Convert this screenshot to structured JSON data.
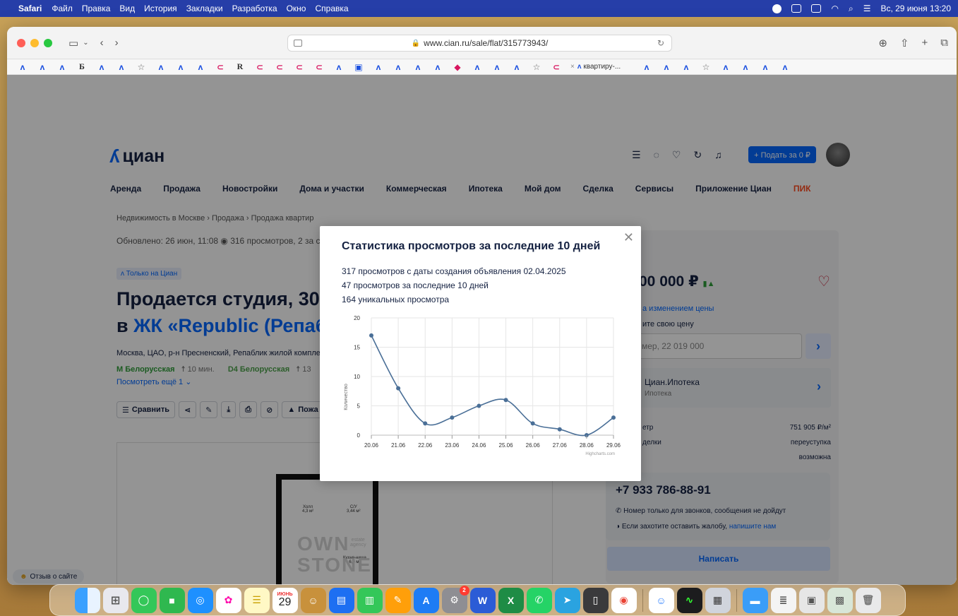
{
  "menubar": {
    "app": "Safari",
    "items": [
      "Файл",
      "Правка",
      "Вид",
      "История",
      "Закладки",
      "Разработка",
      "Окно",
      "Справка"
    ],
    "clock": "Вс, 29 июня 13:20"
  },
  "browser": {
    "url": "www.cian.ru/sale/flat/315773943/",
    "active_tab_label": "квартиру-..."
  },
  "site": {
    "logo": "циан",
    "post_button": "+ Подать за 0 ₽",
    "nav": [
      "Аренда",
      "Продажа",
      "Новостройки",
      "Дома и участки",
      "Коммерческая",
      "Ипотека",
      "Мой дом",
      "Сделка",
      "Сервисы",
      "Приложение Циан",
      "ПИК"
    ]
  },
  "listing": {
    "breadcrumbs": "Недвижимость в Москве  ›  Продажа  ›  Продажа квартир",
    "updated": "Обновлено: 26 июн, 11:08   ◉  316 просмотров, 2 за се",
    "badge": "Только на Циан",
    "title_line1": "Продается студия, 30",
    "title_line2_prefix": "в ",
    "title_line2_link": "ЖК «Republic (Репаб",
    "address": "Москва, ЦАО, р-н Пресненский, Репаблик жилой компле",
    "metro1": "М Белорусская",
    "metro1_time": "☨ 10 мин.",
    "metro2": "D4 Белорусская",
    "metro2_time": "☨ 13",
    "show_more": "Посмотреть ещё 1  ⌄",
    "compare": "Сравнить",
    "complain": "Пожа"
  },
  "plan": {
    "hall": "Холл\n4,3 м²",
    "bath": "С/У\n3,44 м²",
    "kitchen": "Кухня-ниша\n6,0 м²",
    "watermark": "OWN\nSTONE",
    "agency": "estate\nagency"
  },
  "aside": {
    "price": "00 000 ₽",
    "watch_price": "а изменением цены",
    "your_price": "ите свою цену",
    "price_placeholder": "мер, 22 019 000",
    "mortgage_title": "Циан.Ипотека",
    "mortgage_sub": "Ипотека",
    "price_per_meter_label": "етр",
    "price_per_meter_value": "751 905 ₽/м²",
    "deal_label": "делки",
    "deal_value": "переуступка",
    "possible_value": "возможна",
    "phone": "+7 933 786-88-91",
    "phone_note1": "Номер только для звонков, сообщения не дойдут",
    "phone_note2_prefix": "Если захотите оставить жалобу, ",
    "phone_note2_link": "напишите нам",
    "write_button": "Написать"
  },
  "feedback": "Отзыв о сайте",
  "modal": {
    "title": "Статистика просмотров за последние 10 дней",
    "line1": "317 просмотров с даты создания объявления 02.04.2025",
    "line2": "47 просмотров за последние 10 дней",
    "line3": "164 уникальных просмотра",
    "credit": "Highcharts.com"
  },
  "chart_data": {
    "type": "line",
    "categories": [
      "20.06",
      "21.06",
      "22.06",
      "23.06",
      "24.06",
      "25.06",
      "26.06",
      "27.06",
      "28.06",
      "29.06"
    ],
    "values": [
      17,
      8,
      2,
      3,
      5,
      6,
      2,
      1,
      0,
      3
    ],
    "ylabel": "Количество",
    "ylim": [
      0,
      20
    ],
    "yticks": [
      0,
      5,
      10,
      15,
      20
    ],
    "grid": true,
    "color": "#4a6f97"
  },
  "dock": {
    "calendar_month": "ИЮНЬ",
    "calendar_day": "29",
    "badge": "2"
  }
}
